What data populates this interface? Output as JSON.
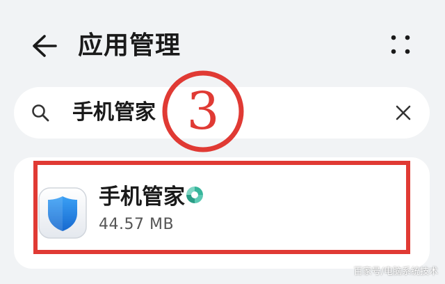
{
  "header": {
    "title": "应用管理",
    "back_icon": "arrow-left-icon",
    "more_icon": "more-grid-icon"
  },
  "search": {
    "value": "手机管家",
    "icon": "search-icon",
    "clear_icon": "close-icon"
  },
  "annotation": {
    "step_label": "③",
    "color": "#e03a34"
  },
  "app": {
    "name": "手机管家",
    "size": "44.57 MB",
    "icon": "shield-app-icon",
    "badge_icon": "verified-badge-icon"
  },
  "watermark": {
    "text": "百家号/电脑系统技术"
  },
  "colors": {
    "background": "#f1f3f5",
    "card": "#ffffff",
    "accent_red": "#e03a34",
    "shield_blue": "#2b8be8",
    "badge_teal": "#37b59b"
  }
}
